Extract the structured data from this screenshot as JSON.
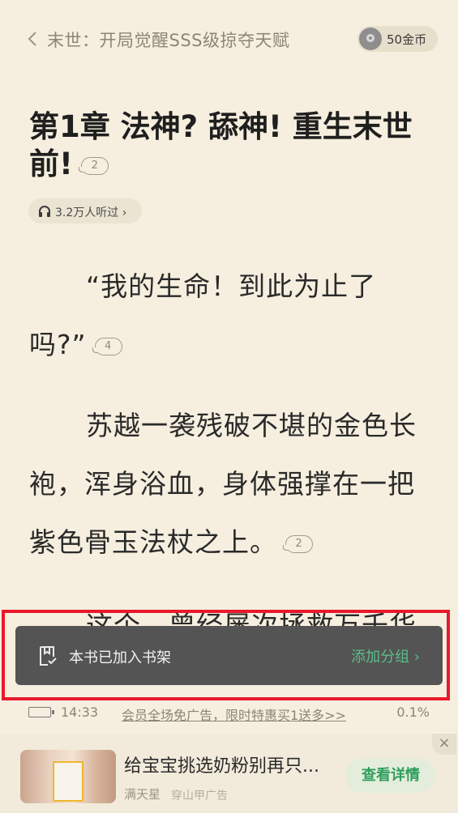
{
  "header": {
    "book_title": "末世：开局觉醒SSS级掠夺天赋",
    "coins_label": "50金币"
  },
  "chapter": {
    "title": "第1章 法神? 舔神! 重生末世前!",
    "title_comment_count": "2",
    "listen_count": "3.2万人听过"
  },
  "paragraphs": [
    {
      "text": "“我的生命！到此为止了吗?”",
      "comment_count": "4"
    },
    {
      "text": "苏越一袭残破不堪的金色长袍，浑身浴血，身体强撑在一把紫色骨玉法杖之上。",
      "comment_count": "2"
    },
    {
      "text": "这个，曾经屡次拯救万千华"
    }
  ],
  "toast": {
    "message": "本书已加入书架",
    "action": "添加分组"
  },
  "status": {
    "time": "14:33",
    "promo": "会员全场免广告，限时特惠买1送多>>",
    "progress": "0.1%"
  },
  "ad": {
    "title": "给宝宝挑选奶粉别再只...",
    "brand": "满天星",
    "source": "穿山甲广告",
    "button": "查看详情",
    "close": "×"
  },
  "colors": {
    "background": "#f6efdf",
    "toast_bg": "#545454",
    "accent_green": "#5bbd87",
    "highlight_red": "#e8192c"
  }
}
